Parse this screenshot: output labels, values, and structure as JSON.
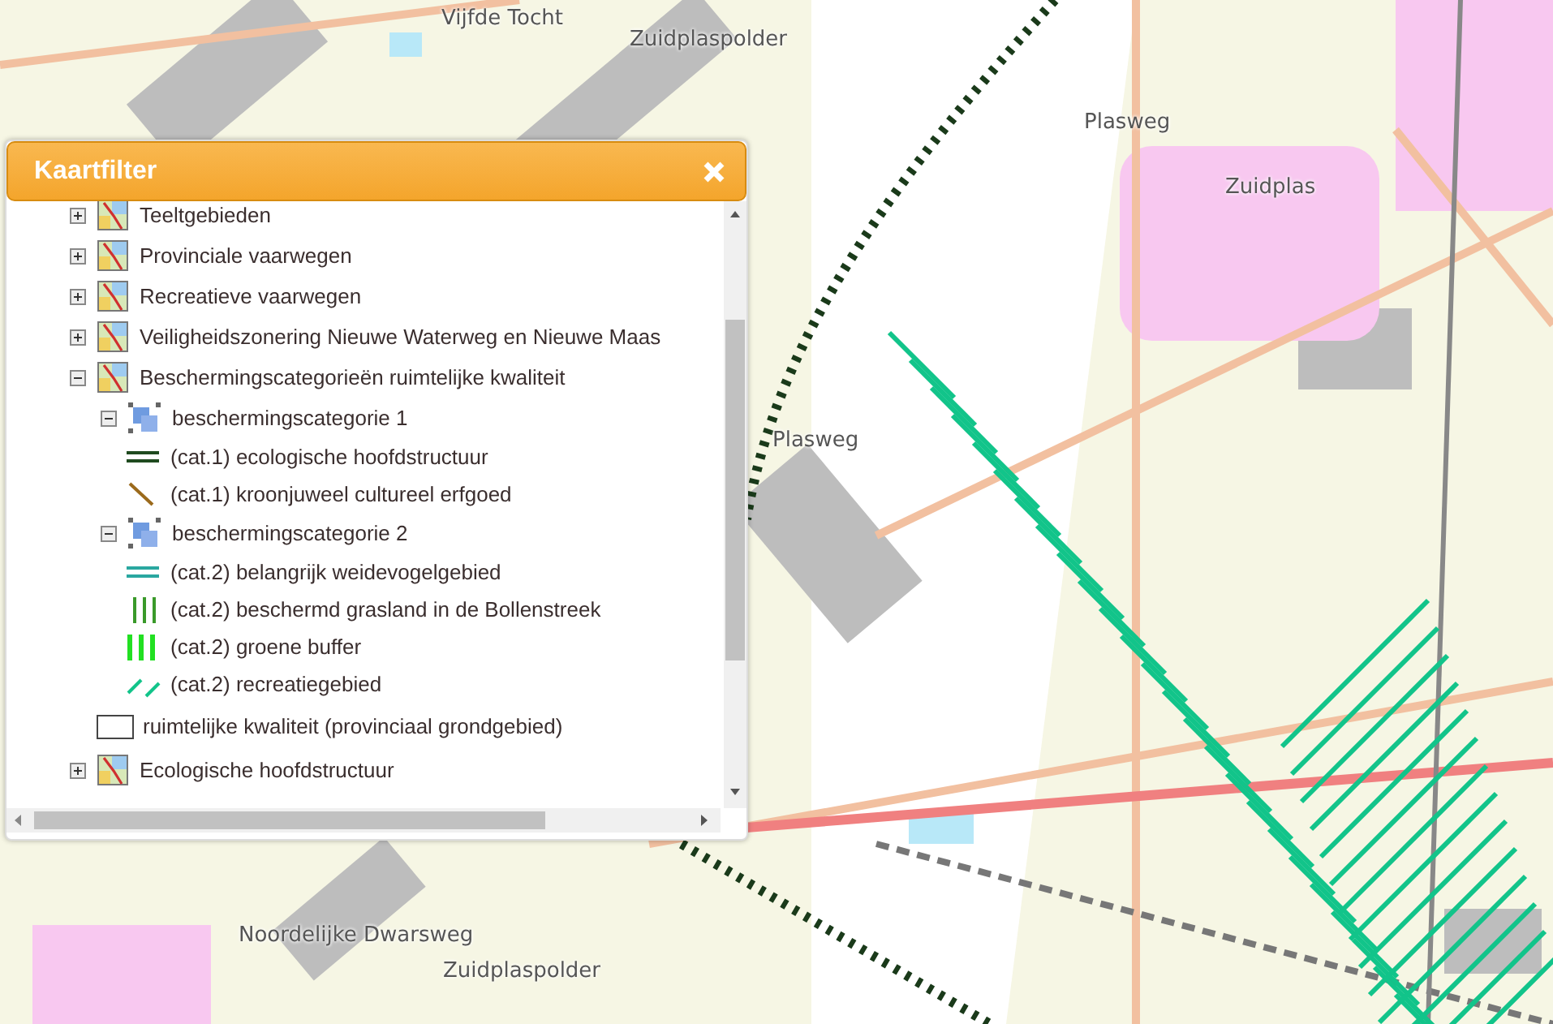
{
  "map": {
    "labels": [
      {
        "text": "Vijfde Tocht"
      },
      {
        "text": "Zuidplaspolder"
      },
      {
        "text": "Plasweg"
      },
      {
        "text": "Zuidplas"
      },
      {
        "text": "Plasweg"
      },
      {
        "text": "Noordelijke Dwarsweg"
      },
      {
        "text": "Zuidplaspolder"
      }
    ]
  },
  "panel": {
    "title": "Kaartfilter",
    "layers": [
      {
        "kind": "layer",
        "label": "Teeltgebieden",
        "expanded": false
      },
      {
        "kind": "layer",
        "label": "Provinciale vaarwegen",
        "expanded": false
      },
      {
        "kind": "layer",
        "label": "Recreatieve vaarwegen",
        "expanded": false
      },
      {
        "kind": "layer",
        "label": "Veiligheidszonering Nieuwe Waterweg en Nieuwe Maas",
        "expanded": false
      },
      {
        "kind": "layer",
        "label": "Beschermingscategorieën ruimtelijke kwaliteit",
        "expanded": true,
        "children": [
          {
            "kind": "group",
            "label": "beschermingscategorie 1",
            "expanded": true,
            "children": [
              {
                "kind": "legend",
                "swatch": {
                  "kind": "double-line",
                  "color": "#1f4a1f"
                },
                "label": "(cat.1) ecologische hoofdstructuur"
              },
              {
                "kind": "legend",
                "swatch": {
                  "kind": "diagonal-down",
                  "color": "#9b6a1c"
                },
                "label": "(cat.1) kroonjuweel cultureel erfgoed"
              }
            ]
          },
          {
            "kind": "group",
            "label": "beschermingscategorie 2",
            "expanded": true,
            "children": [
              {
                "kind": "legend",
                "swatch": {
                  "kind": "double-line",
                  "color": "#2aa7a0"
                },
                "label": "(cat.2) belangrijk weidevogelgebied"
              },
              {
                "kind": "legend",
                "swatch": {
                  "kind": "vertical",
                  "color": "#3a9a2a"
                },
                "label": "(cat.2) beschermd grasland in de Bollenstreek"
              },
              {
                "kind": "legend",
                "swatch": {
                  "kind": "vertical-bold",
                  "color": "#22e022"
                },
                "label": "(cat.2) groene buffer"
              },
              {
                "kind": "legend",
                "swatch": {
                  "kind": "diagonal-up",
                  "color": "#12c48a"
                },
                "label": "(cat.2) recreatiegebied"
              }
            ]
          },
          {
            "kind": "legend",
            "swatch": {
              "kind": "outline",
              "color": "#444444"
            },
            "label": "ruimtelijke kwaliteit (provinciaal grondgebied)"
          }
        ]
      },
      {
        "kind": "layer",
        "label": "Ecologische hoofdstructuur",
        "expanded": false
      }
    ]
  }
}
